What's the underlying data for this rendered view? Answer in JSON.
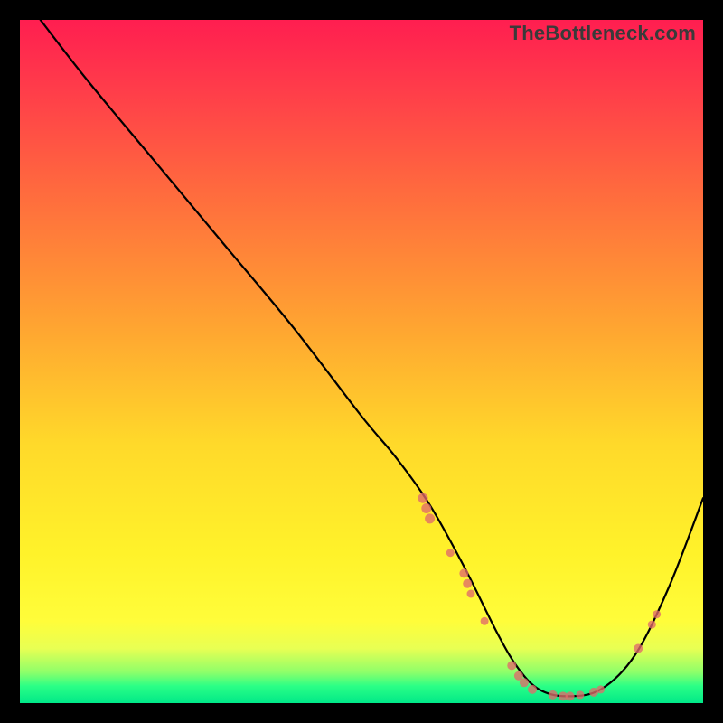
{
  "watermark": "TheBottleneck.com",
  "chart_data": {
    "type": "line",
    "title": "",
    "xlabel": "",
    "ylabel": "",
    "xlim": [
      0,
      100
    ],
    "ylim": [
      0,
      100
    ],
    "grid": false,
    "legend": false,
    "series": [
      {
        "name": "curve",
        "x": [
          3,
          10,
          20,
          30,
          40,
          50,
          55,
          60,
          65,
          70,
          73,
          76,
          80,
          85,
          90,
          95,
          100
        ],
        "y": [
          100,
          91,
          79,
          67,
          55,
          42,
          36,
          29,
          20,
          10,
          5,
          2,
          1,
          2,
          7,
          17,
          30
        ]
      }
    ],
    "markers": [
      {
        "x": 59.0,
        "y": 30.0,
        "r": 5.5
      },
      {
        "x": 59.5,
        "y": 28.5,
        "r": 5.5
      },
      {
        "x": 60.0,
        "y": 27.0,
        "r": 5.5
      },
      {
        "x": 63.0,
        "y": 22.0,
        "r": 4.5
      },
      {
        "x": 65.0,
        "y": 19.0,
        "r": 5.0
      },
      {
        "x": 65.5,
        "y": 17.5,
        "r": 5.0
      },
      {
        "x": 66.0,
        "y": 16.0,
        "r": 4.5
      },
      {
        "x": 68.0,
        "y": 12.0,
        "r": 4.5
      },
      {
        "x": 72.0,
        "y": 5.5,
        "r": 5.0
      },
      {
        "x": 73.0,
        "y": 4.0,
        "r": 5.0
      },
      {
        "x": 73.8,
        "y": 3.0,
        "r": 5.0
      },
      {
        "x": 75.0,
        "y": 2.0,
        "r": 5.0
      },
      {
        "x": 78.0,
        "y": 1.2,
        "r": 5.0
      },
      {
        "x": 79.5,
        "y": 1.0,
        "r": 5.0
      },
      {
        "x": 80.5,
        "y": 1.0,
        "r": 5.0
      },
      {
        "x": 82.0,
        "y": 1.2,
        "r": 4.5
      },
      {
        "x": 84.0,
        "y": 1.6,
        "r": 5.0
      },
      {
        "x": 85.0,
        "y": 2.0,
        "r": 4.5
      },
      {
        "x": 90.5,
        "y": 8.0,
        "r": 5.0
      },
      {
        "x": 92.5,
        "y": 11.5,
        "r": 4.5
      },
      {
        "x": 93.2,
        "y": 13.0,
        "r": 4.5
      }
    ]
  }
}
